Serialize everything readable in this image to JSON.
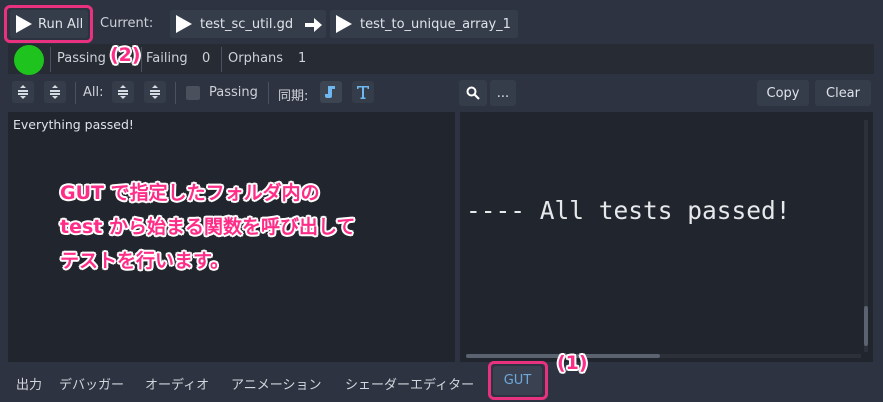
{
  "toolbar": {
    "run_all_label": "Run All",
    "current_label": "Current:",
    "current_script": "test_sc_util.gd",
    "current_test": "test_to_unique_array_1"
  },
  "summary": {
    "status_color": "#1ec31e",
    "passing_label": "Passing",
    "failing_label": "Failing",
    "failing_count": "0",
    "orphans_label": "Orphans",
    "orphans_count": "1"
  },
  "controls": {
    "all_label": "All:",
    "passing_filter_label": "Passing",
    "sync_label": "同期:",
    "more_label": "...",
    "copy_label": "Copy",
    "clear_label": "Clear"
  },
  "left_panel": {
    "message": "Everything passed!"
  },
  "right_panel": {
    "output_text": "---- All tests passed!"
  },
  "bottom_tabs": [
    {
      "label": "出力"
    },
    {
      "label": "デバッガー"
    },
    {
      "label": "オーディオ"
    },
    {
      "label": "アニメーション"
    },
    {
      "label": "シェーダーエディター"
    },
    {
      "label": "GUT",
      "active": true
    }
  ],
  "annotations": {
    "marker_1": "(1)",
    "marker_2": "(2)",
    "note_line1": "GUT で指定したフォルダ内の",
    "note_line2": "test から始まる関数を呼び出して",
    "note_line3": "テストを行います。"
  },
  "colors": {
    "accent": "#e8317f",
    "active_tab": "#6fa8dc",
    "panel_bg": "#21252d",
    "editor_bg": "#2d3340"
  }
}
